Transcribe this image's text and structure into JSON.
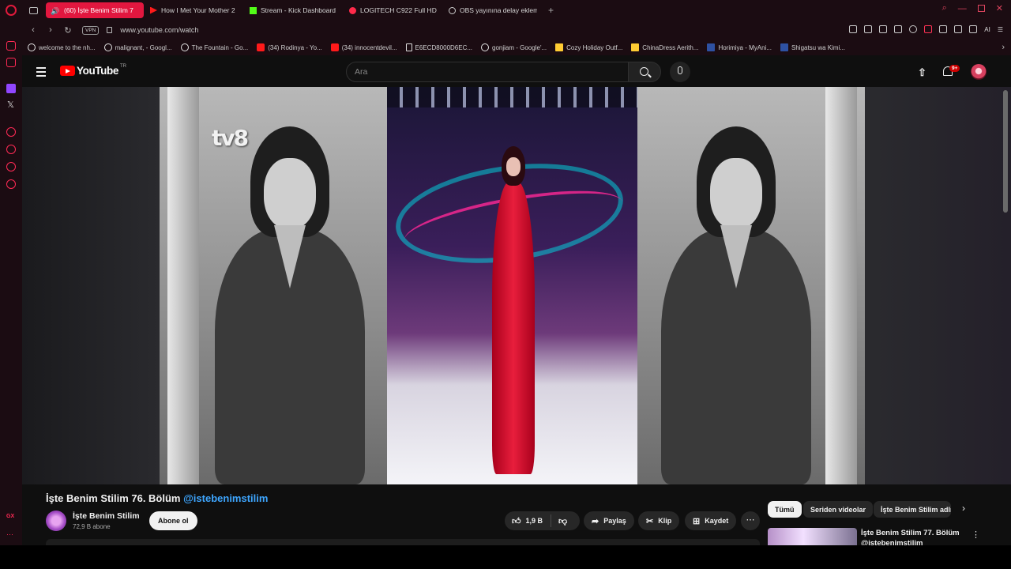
{
  "browser": {
    "tabs": [
      {
        "label": "(60) İşte Benim Stilim 7",
        "favicon": "volume-icon",
        "active": true
      },
      {
        "label": "How I Met Your Mother 2",
        "favicon": "youtube-icon",
        "active": false
      },
      {
        "label": "Stream - Kick Dashboard",
        "favicon": "kick-icon",
        "active": false
      },
      {
        "label": "LOGITECH C922 Full HD",
        "favicon": "logitech-icon",
        "active": false
      },
      {
        "label": "OBS yayınına delay ekleme",
        "favicon": "google-icon",
        "active": false
      }
    ],
    "new_tab": "+",
    "vpn": "VPN",
    "url": "www.youtube.com/watch",
    "ai_label": "AI",
    "bookmarks": [
      {
        "label": "welcome to the nh...",
        "icon": "globe-icon"
      },
      {
        "label": "malignant, - Googl...",
        "icon": "google-icon"
      },
      {
        "label": "The Fountain - Go...",
        "icon": "google-icon"
      },
      {
        "label": "(34) Rodinya - Yo...",
        "icon": "youtube-icon"
      },
      {
        "label": "(34) innocentdevil...",
        "icon": "youtube-icon"
      },
      {
        "label": "E6ECD8000D6EC...",
        "icon": "document-icon"
      },
      {
        "label": "gonjiam - Google'...",
        "icon": "google-icon"
      },
      {
        "label": "Cozy Holiday Outf...",
        "icon": "star-icon"
      },
      {
        "label": "ChinaDress Aerith...",
        "icon": "star-icon"
      },
      {
        "label": "Horimiya - MyAni...",
        "icon": "mal-icon"
      },
      {
        "label": "Shigatsu wa Kimi...",
        "icon": "mal-icon"
      }
    ],
    "accent": "#e2173f"
  },
  "youtube": {
    "logo_text": "YouTube",
    "region": "TR",
    "search_placeholder": "Ara",
    "notifications_badge": "9+",
    "video": {
      "watermark": "tv8",
      "title": "İşte Benim Stilim 76. Bölüm",
      "handle": "@istebenimstilim"
    },
    "channel": {
      "name": "İşte Benim Stilim",
      "subscribers": "72,9 B abone",
      "subscribe_label": "Abone ol"
    },
    "actions": {
      "likes": "1,9 B",
      "share": "Paylaş",
      "clip": "Klip",
      "save": "Kaydet"
    },
    "chips": [
      "Tümü",
      "Seriden videolar",
      "İşte Benim Stilim adlı"
    ],
    "recommendation": {
      "title": "İşte Benim Stilim 77. Bölüm",
      "channel": "@istebenimstilim"
    }
  }
}
